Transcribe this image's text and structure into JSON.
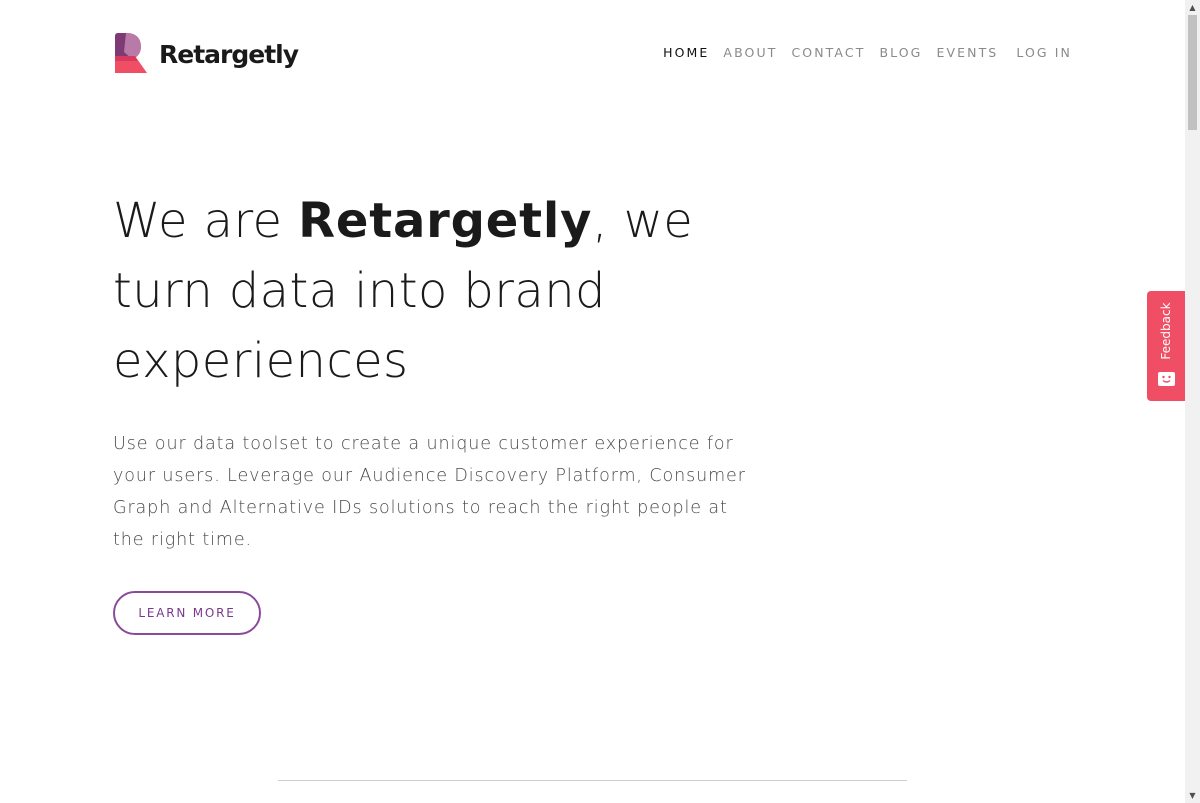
{
  "brand": {
    "name": "Retargetly",
    "colors": {
      "mark_top": "#7e3a74",
      "mark_light": "#b97aa8",
      "mark_bottom": "#f04e64",
      "accent": "#8a4a9a"
    }
  },
  "nav": {
    "items": [
      {
        "label": "HOME",
        "active": true
      },
      {
        "label": "ABOUT",
        "active": false
      },
      {
        "label": "CONTACT",
        "active": false
      },
      {
        "label": "BLOG",
        "active": false
      },
      {
        "label": "EVENTS",
        "active": false
      }
    ],
    "login_label": "LOG IN"
  },
  "hero": {
    "title_prefix": "We are ",
    "title_brand": "Retargetly",
    "title_suffix": ", we turn data into brand experiences",
    "description": "Use our data toolset to create a unique customer experience for your users. Leverage our Audience Discovery Platform, Consumer Graph and Alternative IDs solutions to reach the right people at the right time.",
    "cta_label": "LEARN MORE"
  },
  "feedback": {
    "label": "Feedback",
    "icon": "smiley-chat-icon",
    "color": "#f04e64"
  },
  "scrollbar": {
    "up_icon": "▲",
    "down_icon": "▼"
  }
}
